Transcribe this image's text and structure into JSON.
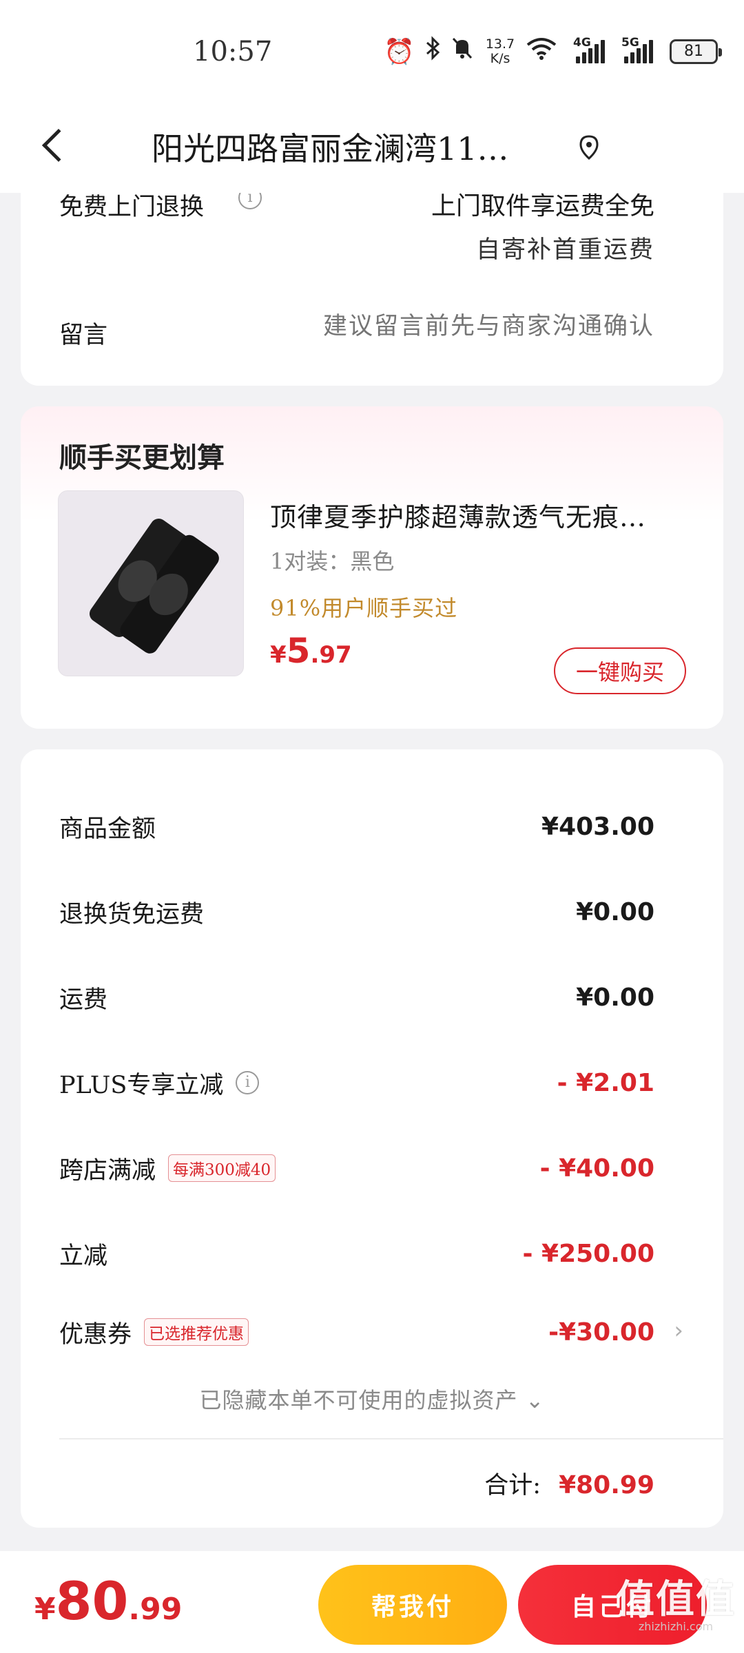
{
  "status_bar": {
    "time": "10:57",
    "net_speed_value": "13.7",
    "net_speed_unit": "K/s",
    "signal1_label": "4G",
    "signal2_label": "5G",
    "battery": "81"
  },
  "header": {
    "address": "阳光四路富丽金澜湾11…"
  },
  "delivery": {
    "return_label": "免费上门退换",
    "return_value_line1": "上门取件享运费全免",
    "return_value_line2": "自寄补首重运费",
    "message_label": "留言",
    "message_placeholder": "建议留言前先与商家沟通确认"
  },
  "addon": {
    "title": "顺手买更划算",
    "product_title": "顶律夏季护膝超薄款透气无痕…",
    "product_spec": "1对装：黑色",
    "social_proof": "91%用户顺手买过",
    "price_currency": "¥",
    "price_int": "5",
    "price_dec": ".97",
    "buy_button": "一键购买"
  },
  "summary": {
    "rows": [
      {
        "label": "商品金额",
        "value": "¥403.00"
      },
      {
        "label": "退换货免运费",
        "value": "¥0.00"
      },
      {
        "label": "运费",
        "value": "¥0.00"
      },
      {
        "label": "PLUS专享立减",
        "value": "- ¥2.01"
      },
      {
        "label": "跨店满减",
        "tag": "每满300减40",
        "value": "- ¥40.00"
      },
      {
        "label": "立减",
        "value": "- ¥250.00"
      },
      {
        "label": "优惠券",
        "tag": "已选推荐优惠",
        "value": "-¥30.00"
      }
    ],
    "hidden_note": "已隐藏本单不可使用的虚拟资产",
    "total_label": "合计:",
    "total_value": "¥80.99"
  },
  "bottom_bar": {
    "pay_currency": "¥",
    "pay_int": "80",
    "pay_dec": ".99",
    "help_pay_button": "帮我付",
    "self_pay_button": "自己付",
    "watermark_text": "值值值",
    "watermark_url": "zhizhizhi.com"
  },
  "colors": {
    "accent_red": "#d9262c",
    "gold": "#c28a2c",
    "help_button": "#ffb815",
    "self_button": "#f02834"
  }
}
